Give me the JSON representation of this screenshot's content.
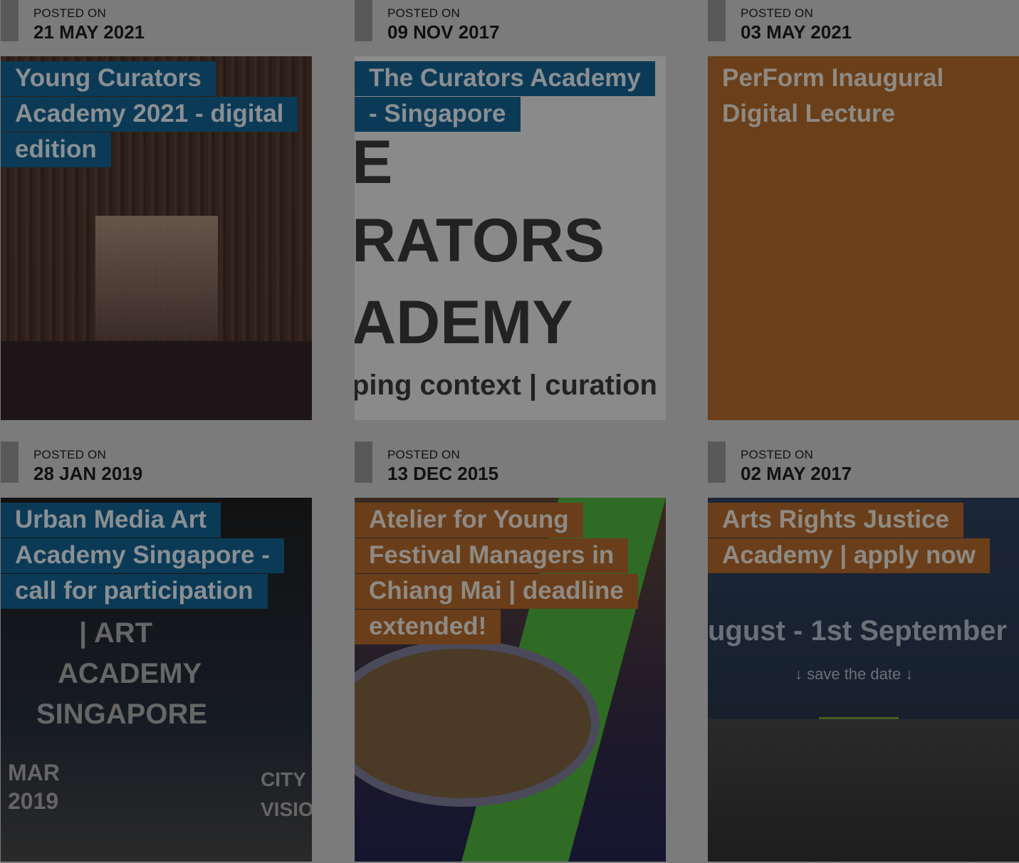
{
  "posts": [
    {
      "posted_label": "POSTED ON",
      "date": "21 MAY 2021",
      "title": "Young Curators Academy 2021 - digital edition",
      "label_color": "blue"
    },
    {
      "posted_label": "POSTED ON",
      "date": "09 NOV 2017",
      "title": "The Curators Academy - Singapore",
      "label_color": "blue",
      "image_text": [
        "E",
        "RATORS",
        "ADEMY",
        "ping context | curation"
      ]
    },
    {
      "posted_label": "POSTED ON",
      "date": "03 MAY 2021",
      "title": "PerForm Inaugural Digital Lecture",
      "label_color": "orange"
    },
    {
      "posted_label": "POSTED ON",
      "date": "28 JAN 2019",
      "title": "Urban Media Art Academy Singapore - call for participation",
      "label_color": "blue",
      "image_text": [
        "| ART",
        "ACADEMY",
        "SINGAPORE",
        "MAR",
        "2019",
        "CITY",
        "VISIO"
      ]
    },
    {
      "posted_label": "POSTED ON",
      "date": "13 DEC 2015",
      "title": "Atelier for Young Festival Managers in Chiang Mai | deadline extended!",
      "label_color": "orange"
    },
    {
      "posted_label": "POSTED ON",
      "date": "02 MAY 2017",
      "title": "Arts Rights Justice Academy | apply now",
      "label_color": "orange",
      "image_text": [
        "ugust - 1st September",
        "↓ save the date ↓"
      ]
    }
  ],
  "colors": {
    "overlay": "#7b7b7b",
    "label_blue": "#0b3a56",
    "label_orange": "#6a3e1a"
  }
}
